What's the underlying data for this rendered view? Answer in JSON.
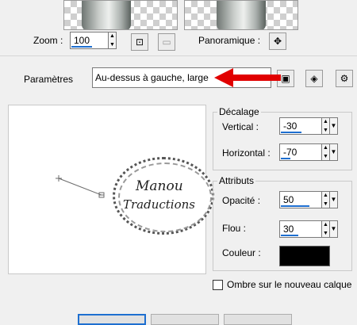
{
  "zoom": {
    "label": "Zoom :",
    "value": "100",
    "level_fraction": 0.5
  },
  "panoramique": {
    "label": "Panoramique :",
    "button_glyph": "✥"
  },
  "parametres": {
    "label": "Paramètres",
    "value": "Au-dessus à gauche, large"
  },
  "decalage": {
    "title": "Décalage",
    "vertical": {
      "label": "Vertical :",
      "value": "-30",
      "level_fraction": 0.4
    },
    "horizontal": {
      "label": "Horizontal :",
      "value": "-70",
      "level_fraction": 0.18
    }
  },
  "attributs": {
    "title": "Attributs",
    "opacite": {
      "label": "Opacité :",
      "value": "50",
      "level_fraction": 0.55
    },
    "flou": {
      "label": "Flou :",
      "value": "30",
      "level_fraction": 0.35
    },
    "couleur": {
      "label": "Couleur :",
      "color": "#000000"
    }
  },
  "checkbox": {
    "label": "Ombre sur le nouveau calque",
    "checked": false
  },
  "watermark": {
    "line1": "Manou",
    "line2": "Traductions"
  },
  "colors": {
    "accent": "#1e6fd0",
    "arrow": "#e10000"
  },
  "icons": [
    "fit-icon",
    "zoom-actual-icon",
    "pan-icon",
    "save-preset-icon",
    "reset-icon",
    "settings-icon"
  ]
}
